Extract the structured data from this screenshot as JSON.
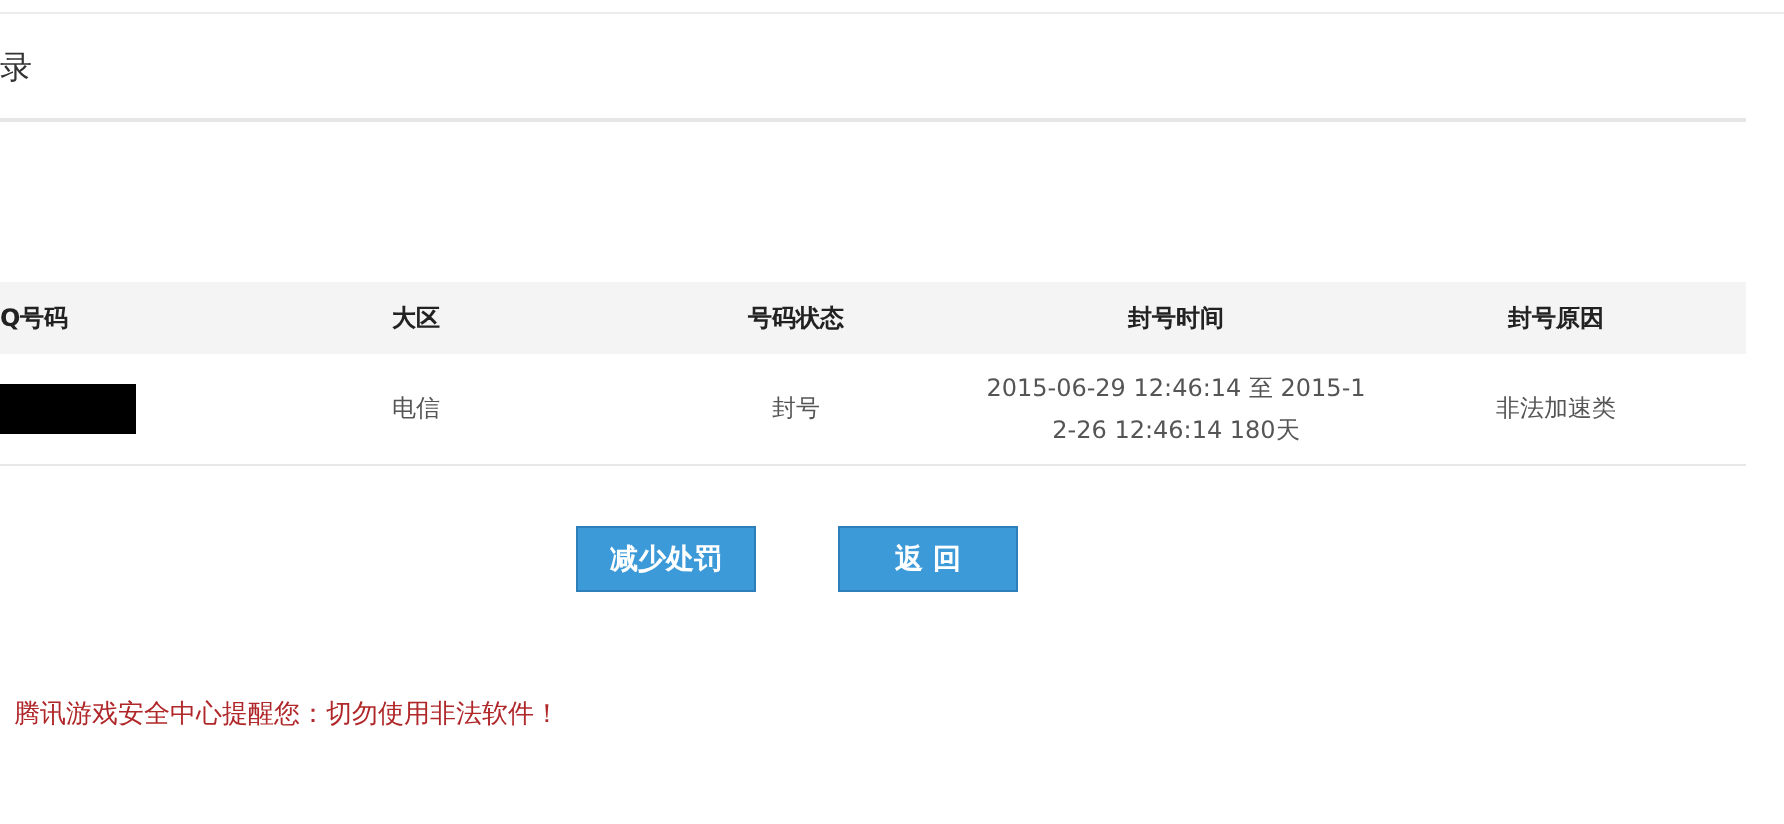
{
  "section_title": "录",
  "table": {
    "columns": [
      "Q号码",
      "大区",
      "号码状态",
      "封号时间",
      "封号原因"
    ],
    "rows": [
      {
        "cells": [
          {
            "kind": "redacted"
          },
          {
            "kind": "text",
            "text": "电信"
          },
          {
            "kind": "text",
            "text": "封号"
          },
          {
            "kind": "text",
            "text": "2015-06-29 12:46:14 至 2015-12-26 12:46:14 180天"
          },
          {
            "kind": "text",
            "text": "非法加速类"
          }
        ]
      }
    ]
  },
  "buttons": [
    "减少处罚",
    "返 回"
  ],
  "notice": "腾讯游戏安全中心提醒您：切勿使用非法软件！"
}
